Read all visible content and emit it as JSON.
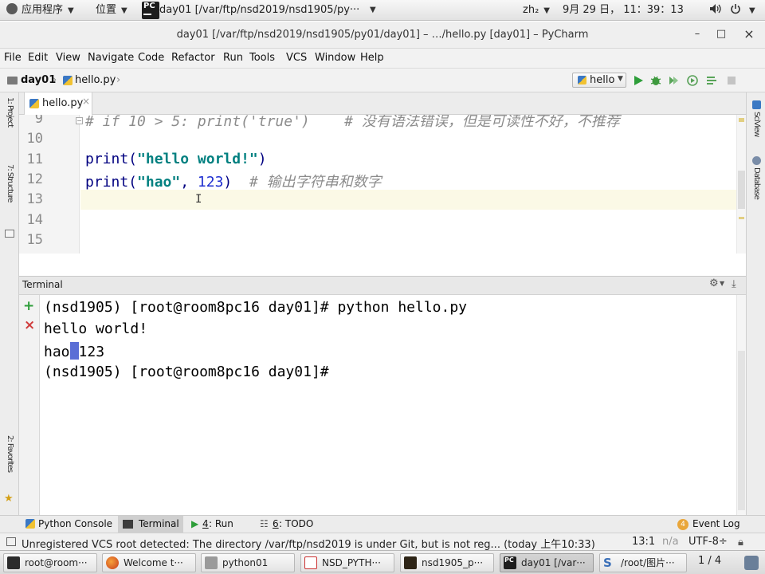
{
  "gnome_panel": {
    "applications_label": "应用程序",
    "places_label": "位置",
    "active_window_label": "day01 [/var/ftp/nsd2019/nsd1905/py···",
    "input_method": "zh₂",
    "datetime": "9月 29 日， 11：39：13"
  },
  "window": {
    "title": "day01 [/var/ftp/nsd2019/nsd1905/py01/day01] – …/hello.py [day01] – PyCharm",
    "minimize": "–",
    "maximize": "□",
    "close": "×"
  },
  "menu": [
    "File",
    "Edit",
    "View",
    "Navigate",
    "Code",
    "Refactor",
    "Run",
    "Tools",
    "VCS",
    "Window",
    "Help"
  ],
  "breadcrumb": {
    "project": "day01",
    "file": "hello.py"
  },
  "run_config": {
    "label": "hello"
  },
  "left_strip": {
    "project_label": "1: Project",
    "structure_label": "7: Structure",
    "favorites_label": "2: Favorites"
  },
  "right_strip": {
    "sciview_label": "SciView",
    "database_label": "Database"
  },
  "editor_tab": {
    "label": "hello.py"
  },
  "editor": {
    "lines": [
      {
        "num": "9",
        "parts": [
          {
            "t": "# if 10 > 5: print('true')    # 没有语法错误，但是可读性不好，不推荐",
            "c": "cmt"
          }
        ]
      },
      {
        "num": "10",
        "parts": []
      },
      {
        "num": "11",
        "parts": [
          {
            "t": "print(",
            "c": "kw"
          },
          {
            "t": "\"hello world!\"",
            "c": "str"
          },
          {
            "t": ")",
            "c": "kw"
          }
        ]
      },
      {
        "num": "12",
        "parts": [
          {
            "t": "print(",
            "c": "kw"
          },
          {
            "t": "\"hao\"",
            "c": "str"
          },
          {
            "t": ", ",
            "c": "kw"
          },
          {
            "t": "123",
            "c": "num"
          },
          {
            "t": ")  ",
            "c": "kw"
          },
          {
            "t": "# 输出字符串和数字",
            "c": "cmt"
          }
        ]
      },
      {
        "num": "13",
        "parts": []
      },
      {
        "num": "14",
        "parts": []
      },
      {
        "num": "15",
        "parts": []
      }
    ]
  },
  "terminal": {
    "title": "Terminal",
    "new_session": "+",
    "close_session": "×",
    "line1": "(nsd1905) [root@room8pc16 day01]# python hello.py",
    "line2": "hello world!",
    "line3_a": "hao",
    "line3_b": "123",
    "line4": "(nsd1905) [root@room8pc16 day01]#"
  },
  "tool_tabs": {
    "python_console": "Python Console",
    "terminal": "Terminal",
    "run_key": "4",
    "run_label": ": Run",
    "todo_key": "6",
    "todo_label": ": TODO",
    "event_log_count": "4",
    "event_log_label": "Event Log"
  },
  "status": {
    "message": "Unregistered VCS root detected: The directory /var/ftp/nsd2019 is under Git, but is not reg... (today 上午10:33)",
    "position": "13:1",
    "na": "n/a",
    "encoding": "UTF-8÷"
  },
  "taskbar": {
    "items": [
      "root@room···",
      "Welcome t···",
      "python01",
      "NSD_PYTH···",
      "nsd1905_p···",
      "day01 [/var···",
      "/root/图片···"
    ],
    "workspace": "1 / 4"
  }
}
